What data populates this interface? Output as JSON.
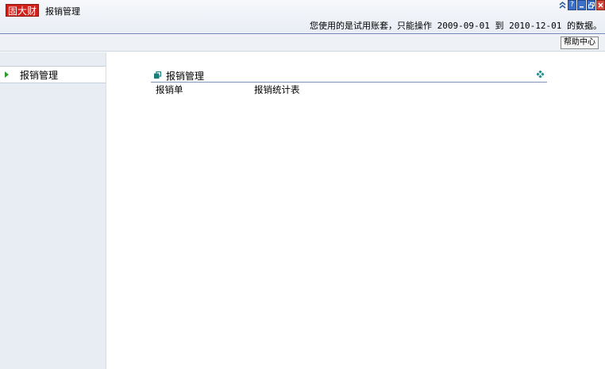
{
  "header": {
    "logo_text": "固大财",
    "app_title": "报销管理",
    "trial_notice": "您使用的是试用账套，只能操作 2009-09-01 到 2010-12-01 的数据。",
    "window_controls": {
      "collapse": "≈",
      "help": "?",
      "minimize": "–",
      "restore": "▫",
      "close": "×"
    }
  },
  "toolbar": {
    "help_center_label": "帮助中心"
  },
  "sidebar": {
    "items": [
      {
        "label": "报销管理",
        "icon": "triangle-right-icon"
      }
    ]
  },
  "main": {
    "panel": {
      "title": "报销管理",
      "links": [
        {
          "label": "报销单"
        },
        {
          "label": "报销统计表"
        }
      ]
    }
  },
  "colors": {
    "logo_red": "#d2221c",
    "header_border": "#6d86b6",
    "sidebar_bg": "#e8ecf3",
    "arrow_green": "#2e9a2e",
    "panel_icon_teal": "#1a7d7b"
  }
}
